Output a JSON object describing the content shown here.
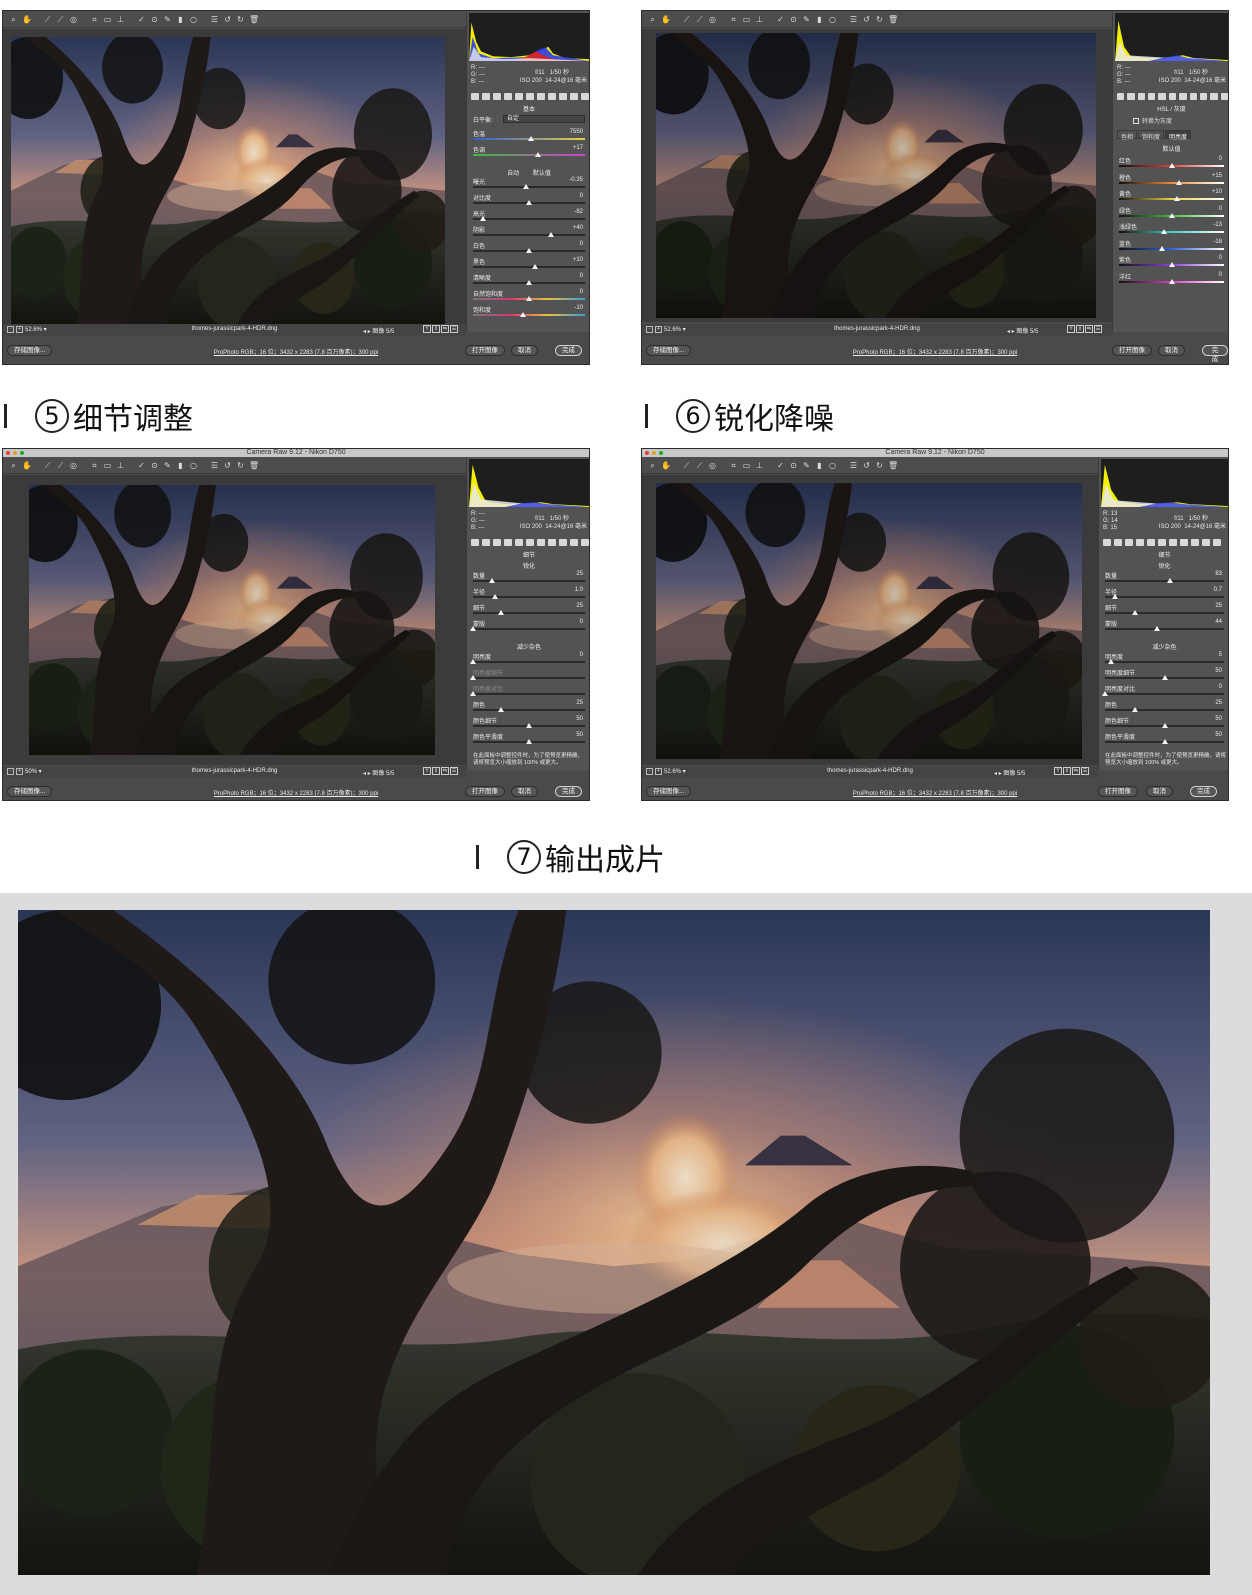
{
  "headings": {
    "step5": {
      "num": "5",
      "text": "细节调整"
    },
    "step6": {
      "num": "6",
      "text": "锐化降噪"
    },
    "step7": {
      "num": "7",
      "text": "输出成片"
    }
  },
  "common": {
    "exif_aperture": "f/11",
    "exif_shutter": "1/50 秒",
    "exif_iso": "ISO 200",
    "exif_lens": "14-24@16 毫米",
    "rgb_r": "R:",
    "rgb_g": "G:",
    "rgb_b": "B:",
    "rgb_blank": "---",
    "filename": "thomes-jurassicpark-4-HDR.dng",
    "image_counter": "图像 5/5",
    "workflow_info": "ProPhoto RGB；16 位；3432 x 2283 (7.8 百万像素)；300 ppi",
    "btn_save": "存储图像...",
    "btn_open": "打开图像",
    "btn_cancel": "取消",
    "btn_done": "完成"
  },
  "window1": {
    "panel_title": "基本",
    "wb_label": "白平衡:",
    "wb_value": "自定",
    "auto": "自动",
    "default": "默认值",
    "zoom": "52.6%",
    "sliders_top": [
      {
        "label": "色温",
        "value": "7550",
        "pos": 0.52
      },
      {
        "label": "色调",
        "value": "+17",
        "pos": 0.58
      }
    ],
    "sliders": [
      {
        "label": "曝光",
        "value": "-0.35",
        "pos": 0.47
      },
      {
        "label": "对比度",
        "value": "0",
        "pos": 0.5
      },
      {
        "label": "高光",
        "value": "-82",
        "pos": 0.09
      },
      {
        "label": "阴影",
        "value": "+40",
        "pos": 0.7
      },
      {
        "label": "白色",
        "value": "0",
        "pos": 0.5
      },
      {
        "label": "黑色",
        "value": "+10",
        "pos": 0.55
      }
    ],
    "sliders_bottom": [
      {
        "label": "清晰度",
        "value": "0",
        "pos": 0.5
      },
      {
        "label": "自然饱和度",
        "value": "0",
        "pos": 0.5
      },
      {
        "label": "饱和度",
        "value": "-10",
        "pos": 0.45
      }
    ]
  },
  "window2": {
    "panel_title": "HSL / 灰度",
    "convert_gray": "转换为灰度",
    "tabs": [
      "色相",
      "饱和度",
      "明亮度"
    ],
    "sub_title": "默认值",
    "zoom": "52.6%",
    "sliders": [
      {
        "label": "红色",
        "value": "0",
        "pos": 0.5
      },
      {
        "label": "橙色",
        "value": "+15",
        "pos": 0.57
      },
      {
        "label": "黄色",
        "value": "+10",
        "pos": 0.55
      },
      {
        "label": "绿色",
        "value": "0",
        "pos": 0.5
      },
      {
        "label": "浅绿色",
        "value": "-13",
        "pos": 0.43
      },
      {
        "label": "蓝色",
        "value": "-18",
        "pos": 0.41
      },
      {
        "label": "紫色",
        "value": "0",
        "pos": 0.5
      },
      {
        "label": "洋红",
        "value": "0",
        "pos": 0.5
      }
    ]
  },
  "window3": {
    "titlebar": "Camera Raw 9.12 - Nikon D750",
    "panel_title": "细节",
    "sharpen_title": "锐化",
    "noise_title": "减少杂色",
    "zoom": "50%",
    "sharpen": [
      {
        "label": "数量",
        "value": "25",
        "pos": 0.17
      },
      {
        "label": "半径",
        "value": "1.0",
        "pos": 0.2
      },
      {
        "label": "细节",
        "value": "25",
        "pos": 0.25
      },
      {
        "label": "蒙版",
        "value": "0",
        "pos": 0.0
      }
    ],
    "noise": [
      {
        "label": "明亮度",
        "value": "0",
        "pos": 0.0,
        "dim": false
      },
      {
        "label": "明亮度细节",
        "value": "",
        "pos": 0.0,
        "dim": true
      },
      {
        "label": "明亮度对比",
        "value": "",
        "pos": 0.0,
        "dim": true
      },
      {
        "label": "颜色",
        "value": "25",
        "pos": 0.25,
        "dim": false
      },
      {
        "label": "颜色细节",
        "value": "50",
        "pos": 0.5,
        "dim": false
      },
      {
        "label": "颜色平滑度",
        "value": "50",
        "pos": 0.5,
        "dim": false
      }
    ],
    "note": "在此面板中调整控件时，为了使预览更精确，请将预览大小缩放到 100% 或更大。"
  },
  "window4": {
    "titlebar": "Camera Raw 9.12 - Nikon D750",
    "panel_title": "细节",
    "sharpen_title": "锐化",
    "noise_title": "减少杂色",
    "zoom": "52.6%",
    "rgb_r": "13",
    "rgb_g": "14",
    "rgb_b": "15",
    "sharpen": [
      {
        "label": "数量",
        "value": "83",
        "pos": 0.55
      },
      {
        "label": "半径",
        "value": "0.7",
        "pos": 0.08
      },
      {
        "label": "细节",
        "value": "25",
        "pos": 0.25
      },
      {
        "label": "蒙版",
        "value": "44",
        "pos": 0.44
      }
    ],
    "noise": [
      {
        "label": "明亮度",
        "value": "5",
        "pos": 0.05,
        "dim": false
      },
      {
        "label": "明亮度细节",
        "value": "50",
        "pos": 0.5,
        "dim": false
      },
      {
        "label": "明亮度对比",
        "value": "0",
        "pos": 0.0,
        "dim": false
      },
      {
        "label": "颜色",
        "value": "25",
        "pos": 0.25,
        "dim": false
      },
      {
        "label": "颜色细节",
        "value": "50",
        "pos": 0.5,
        "dim": false
      },
      {
        "label": "颜色平滑度",
        "value": "50",
        "pos": 0.5,
        "dim": false
      }
    ],
    "note": "在此面板中调整控件时，为了使预览更精确，请将预览大小缩放到 100% 或更大。"
  },
  "colors": {
    "panel_bg": "#535353",
    "window_bg": "#4a4a4a",
    "sky_top": "#3c4a6e",
    "sunset": "#f0a070",
    "foliage": "#2a3320"
  }
}
